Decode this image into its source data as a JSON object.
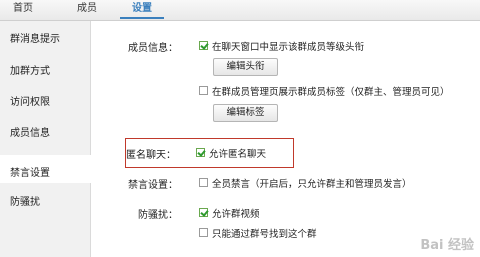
{
  "tabs": [
    {
      "label": "首页"
    },
    {
      "label": "成员"
    },
    {
      "label": "设置"
    }
  ],
  "sidebar": {
    "items": [
      {
        "label": "群消息提示"
      },
      {
        "label": "加群方式"
      },
      {
        "label": "访问权限"
      },
      {
        "label": "成员信息"
      },
      {
        "label": "禁言设置"
      },
      {
        "label": "防骚扰"
      }
    ],
    "active_index": 4
  },
  "member_info": {
    "label": "成员信息：",
    "opt1": {
      "text": "在聊天窗口中显示该群成员等级头衔",
      "checked": true
    },
    "edit_title_button": "编辑头衔",
    "opt2": {
      "text": "在群成员管理页展示群成员标签（仅群主、管理员可见）",
      "checked": false
    },
    "edit_tag_button": "编辑标签"
  },
  "anonymous": {
    "label": "匿名聊天：",
    "opt": {
      "text": "允许匿名聊天",
      "checked": true
    }
  },
  "mute": {
    "label": "禁言设置：",
    "opt": {
      "text": "全员禁言（开启后，只允许群主和管理员发言）",
      "checked": false
    }
  },
  "anti_harass": {
    "label": "防骚扰：",
    "opt1": {
      "text": "允许群视频",
      "checked": true
    },
    "opt2": {
      "text": "只能通过群号找到这个群",
      "checked": false
    }
  },
  "watermark": "Bai 经验",
  "colors": {
    "accent": "#3a7fbd",
    "highlight_border": "#c0392b",
    "check": "#2e9a2e"
  }
}
